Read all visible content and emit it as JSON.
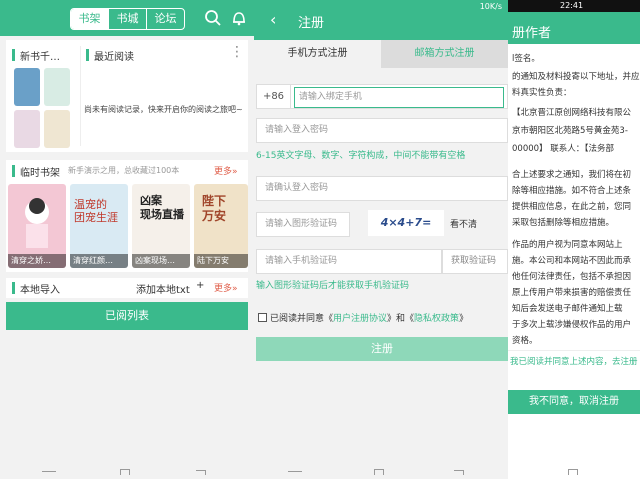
{
  "p1": {
    "tabs": [
      "书架",
      "书城",
      "论坛"
    ],
    "new_books": "新书千…",
    "recent_read": "最近阅读",
    "recent_empty": "尚未有阅读记录，快来开启你的阅读之旅吧~",
    "temp_shelf": "临时书架",
    "temp_hint": "新手演示之用，总收藏过100本",
    "more1": "更多»",
    "covers": [
      {
        "caption": "清穿之娇…",
        "art": "",
        "bg": "#f3c7d4"
      },
      {
        "caption": "清穿红颜…",
        "art": "温宠的\n团宠生涯",
        "bg": "#d9eaf3"
      },
      {
        "caption": "凶案现场…",
        "art": "凶案\n现场直播",
        "bg": "#f5f0ea"
      },
      {
        "caption": "陆下万安",
        "art": "陛下\n万安",
        "bg": "#f0e2c8"
      }
    ],
    "local_import": "本地导入",
    "add_txt": "添加本地txt",
    "plus": "+",
    "more2": "更多»",
    "read_list": "已阅列表"
  },
  "p2": {
    "title": "注册",
    "tab_phone": "手机方式注册",
    "tab_email": "邮箱方式注册",
    "prefix": "+86",
    "phone_placeholder": "请输入绑定手机",
    "password_placeholder": "请输入登入密码",
    "password_hint": "6-15英文字母、数字、字符构成，中间不能带有空格",
    "confirm_placeholder": "请确认登入密码",
    "captcha_placeholder": "请输入图形验证码",
    "captcha_text": "4×4+7=",
    "captcha_refresh": "看不清",
    "sms_placeholder": "请输入手机验证码",
    "sms_button": "获取验证码",
    "sms_hint": "输入图形验证码后才能获取手机验证码",
    "agree_prefix": "已阅读并同意《",
    "agreement1": "用户注册协议",
    "agree_mid": "》和《",
    "agreement2": "隐私权政策",
    "agree_suffix": "》",
    "register_button": "注册",
    "status_time": "10K/s"
  },
  "p3": {
    "status_time": "22:41",
    "title": "册作者",
    "lines": [
      "l签名。",
      "的通知及材料投寄以下地址，并应",
      "料真实性负责：",
      "【北京晋江原创网络科技有限公",
      "京市朝阳区北苑路5号黄金苑3-",
      "00000】     联系人：【法务部",
      "合上述要求之通知，我们将在初",
      "除等相应措施。如不符合上述条",
      "提供相应信息，在此之前，您同",
      "采取包括删除等相应措施。",
      "作品的用户视为同意本网站上",
      "施。本公司和本网站不因此而承",
      "他任何法律责任，包括不承担因",
      "原上传用户带来损害的赔偿责任",
      "知后会发送电子邮件通知上载",
      "于多次上载涉嫌侵权作品的用户",
      "资格。"
    ],
    "agree_bar": "我已阅读并同意上述内容，去注册",
    "cancel_button": "我不同意，取消注册"
  }
}
